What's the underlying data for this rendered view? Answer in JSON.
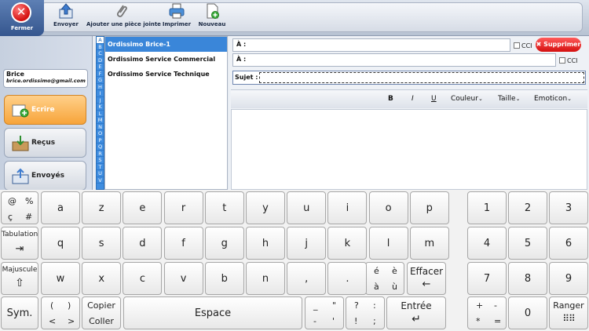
{
  "toolbar": {
    "fermer_label": "Fermer",
    "buttons": [
      {
        "label": "Envoyer"
      },
      {
        "label": "Ajouter une pièce jointe"
      },
      {
        "label": "Imprimer"
      },
      {
        "label": "Nouveau"
      }
    ]
  },
  "user": {
    "name": "Brice",
    "email": "brice.ordissimo@gmail.com"
  },
  "nav": {
    "ecrire": "Ecrire",
    "recus": "Reçus",
    "envoyes": "Envoyés"
  },
  "alphabet": [
    "A",
    "B",
    "C",
    "D",
    "E",
    "F",
    "G",
    "H",
    "I",
    "J",
    "K",
    "L",
    "M",
    "N",
    "O",
    "P",
    "Q",
    "R",
    "S",
    "T",
    "U",
    "V"
  ],
  "contacts": [
    "Ordissimo Brice-1",
    "Ordissimo Service Commercial",
    "Ordissimo Service Technique"
  ],
  "compose": {
    "to_label": "À :",
    "cc_label": "À :",
    "cci_label": "CCI",
    "cci_label_2": "CCI",
    "delete_label": "Supprimer",
    "subject_label": "Sujet :",
    "format": {
      "bold": "B",
      "italic": "I",
      "underline": "U",
      "color": "Couleur",
      "size": "Taille",
      "emoticon": "Emoticon"
    }
  },
  "keyboard": {
    "row1": [
      "a",
      "z",
      "e",
      "r",
      "t",
      "y",
      "u",
      "i",
      "o",
      "p"
    ],
    "row2": [
      "q",
      "s",
      "d",
      "f",
      "g",
      "h",
      "j",
      "k",
      "l",
      "m"
    ],
    "row3": [
      "w",
      "x",
      "c",
      "v",
      "b",
      "n",
      ",",
      "."
    ],
    "numpad": [
      "1",
      "2",
      "3",
      "4",
      "5",
      "6",
      "7",
      "8",
      "9"
    ],
    "special": {
      "sym_top": [
        "@",
        "%",
        "ç",
        "#"
      ],
      "tab": "Tabulation",
      "shift": "Majuscule",
      "sym": "Sym.",
      "paren": [
        "(",
        ")",
        "<",
        ">"
      ],
      "copy": "Copier",
      "paste": "Coller",
      "space": "Espace",
      "dash": [
        "_",
        "\"",
        "-",
        "'"
      ],
      "punct": [
        "?",
        ":",
        "!",
        ";"
      ],
      "enter": "Entrée",
      "erase": "Effacer",
      "accents": [
        "é",
        "è",
        "à",
        "ù"
      ],
      "ops": [
        "+",
        "-",
        "*",
        "="
      ],
      "zero": "0",
      "ranger": "Ranger"
    }
  }
}
